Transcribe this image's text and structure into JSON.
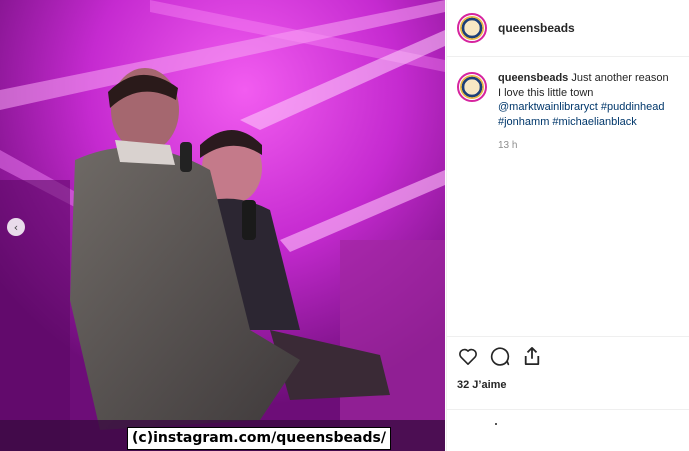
{
  "photo": {
    "prev_arrow": "‹",
    "watermark": "(c)instagram.com/queensbeads/",
    "background_color": "#8a1596"
  },
  "post": {
    "username": "queensbeads",
    "comment": {
      "username": "queensbeads",
      "text": "Just another reason I love this little town",
      "tags": [
        "@marktwainlibraryct",
        "#puddinhead",
        "#jonhamm",
        "#michaelianblack"
      ],
      "time": "13 h"
    },
    "likes": "32 J’aime",
    "accent_link_color": "#00376b"
  },
  "icons": {
    "like": "heart-icon",
    "comment": "comment-bubble-icon",
    "share": "share-icon",
    "prev": "chevron-left-icon"
  }
}
